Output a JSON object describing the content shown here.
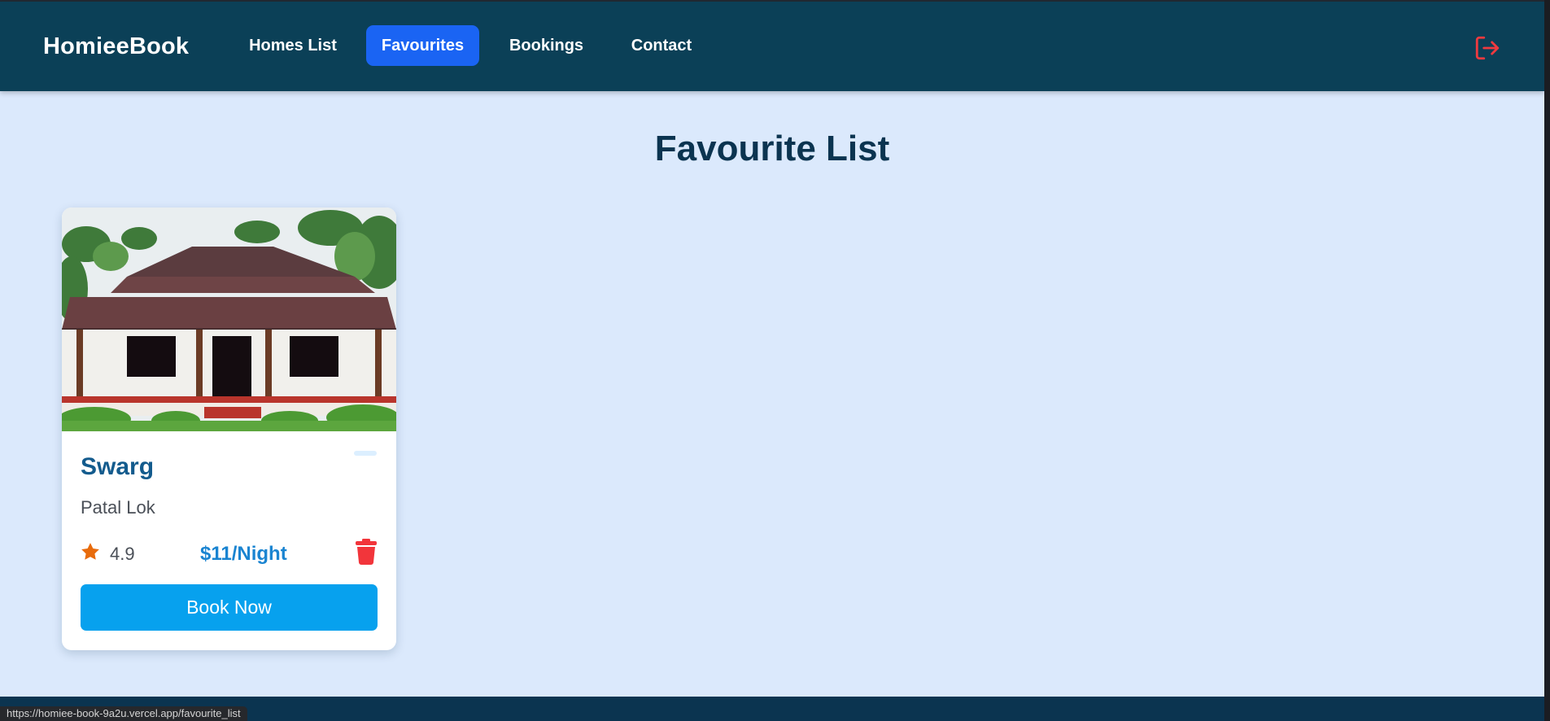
{
  "navbar": {
    "brand": "HomieeBook",
    "links": [
      {
        "label": "Homes List",
        "active": false
      },
      {
        "label": "Favourites",
        "active": true
      },
      {
        "label": "Bookings",
        "active": false
      },
      {
        "label": "Contact",
        "active": false
      }
    ],
    "logout_icon": "logout-icon"
  },
  "main": {
    "title": "Favourite List",
    "cards": [
      {
        "name": "Swarg",
        "location": "Patal Lok",
        "rating": "4.9",
        "price": "$11/Night",
        "book_label": "Book Now",
        "image_icon": "house-photo",
        "rating_icon": "star-icon",
        "delete_icon": "trash-icon"
      }
    ]
  },
  "status_bar": {
    "url": "https://homiee-book-9a2u.vercel.app/favourite_list"
  },
  "colors": {
    "navbar_bg": "#0b4057",
    "active_tab": "#1a64f3",
    "page_bg": "#dbe9fc",
    "title": "#0b3450",
    "price": "#1a84d1",
    "book_button": "#07a1ee",
    "danger": "#f2353b",
    "star": "#e86b0c"
  }
}
